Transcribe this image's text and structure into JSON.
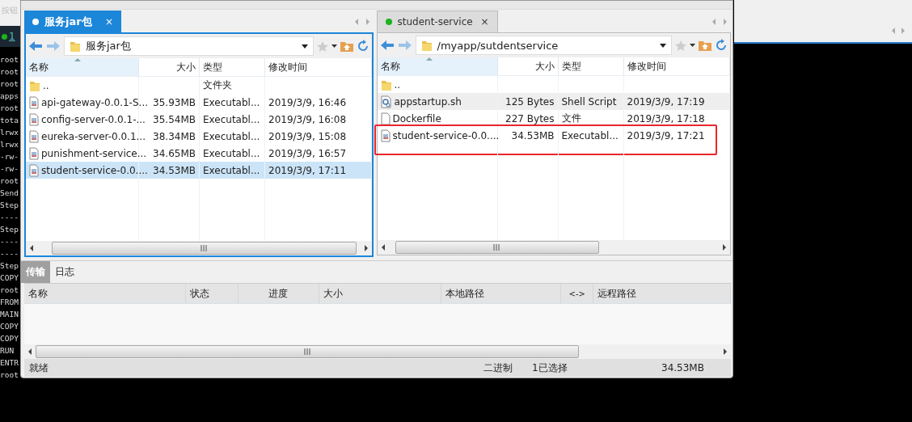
{
  "terminal": {
    "tab_label": "1",
    "lines": [
      "root",
      "root",
      "root",
      "apps",
      "root",
      "tota",
      "lrwx",
      "lrwx",
      "-rw-",
      "-rw-",
      "root",
      "Send",
      "Step",
      "----",
      "Step",
      "----",
      "----",
      "Step",
      "COPY",
      "root",
      "FROM",
      "MAIN",
      "COPY",
      "COPY",
      "RUN",
      "ENTR",
      "root"
    ]
  },
  "background_hint": "按钮",
  "panes": [
    {
      "tab": {
        "label": "服务jar包",
        "active": true,
        "color": "#ffffff",
        "close": "×"
      },
      "path": "服务jar包",
      "columns": [
        "名称",
        "大小",
        "类型",
        "修改时间"
      ],
      "rows": [
        {
          "kind": "folder",
          "name": "..",
          "size": "",
          "type": "文件夹",
          "modified": "",
          "selected": false,
          "hovered": false,
          "highlighted": false
        },
        {
          "kind": "executable",
          "name": "api-gateway-0.0.1-S...",
          "size": "35.93MB",
          "type": "Executabl...",
          "modified": "2019/3/9, 16:46",
          "selected": false,
          "hovered": false,
          "highlighted": false
        },
        {
          "kind": "executable",
          "name": "config-server-0.0.1-...",
          "size": "35.54MB",
          "type": "Executabl...",
          "modified": "2019/3/9, 16:08",
          "selected": false,
          "hovered": false,
          "highlighted": false
        },
        {
          "kind": "executable",
          "name": "eureka-server-0.0.1...",
          "size": "38.34MB",
          "type": "Executabl...",
          "modified": "2019/3/9, 15:08",
          "selected": false,
          "hovered": false,
          "highlighted": false
        },
        {
          "kind": "executable",
          "name": "punishment-service...",
          "size": "34.65MB",
          "type": "Executabl...",
          "modified": "2019/3/9, 16:57",
          "selected": false,
          "hovered": false,
          "highlighted": false
        },
        {
          "kind": "executable",
          "name": "student-service-0.0....",
          "size": "34.53MB",
          "type": "Executabl...",
          "modified": "2019/3/9, 17:11",
          "selected": true,
          "hovered": false,
          "highlighted": false
        }
      ]
    },
    {
      "tab": {
        "label": "student-service",
        "active": false,
        "color": "#1db31d",
        "close": "×"
      },
      "path": "/myapp/sutdentservice",
      "columns": [
        "名称",
        "大小",
        "类型",
        "修改时间"
      ],
      "rows": [
        {
          "kind": "folder",
          "name": "..",
          "size": "",
          "type": "",
          "modified": "",
          "selected": false,
          "hovered": false,
          "highlighted": false
        },
        {
          "kind": "script",
          "name": "appstartup.sh",
          "size": "125 Bytes",
          "type": "Shell Script",
          "modified": "2019/3/9, 17:19",
          "selected": false,
          "hovered": true,
          "highlighted": false
        },
        {
          "kind": "file",
          "name": "Dockerfile",
          "size": "227 Bytes",
          "type": "文件",
          "modified": "2019/3/9, 17:18",
          "selected": false,
          "hovered": false,
          "highlighted": false
        },
        {
          "kind": "executable",
          "name": "student-service-0.0....",
          "size": "34.53MB",
          "type": "Executabl...",
          "modified": "2019/3/9, 17:21",
          "selected": false,
          "hovered": false,
          "highlighted": true
        }
      ]
    }
  ],
  "bottom_tabs": [
    {
      "label": "传输",
      "selected": true
    },
    {
      "label": "日志",
      "selected": false
    }
  ],
  "transfer_columns": [
    "名称",
    "状态",
    "进度",
    "大小",
    "本地路径",
    "<->",
    "远程路径"
  ],
  "status_bar": {
    "state": "就绪",
    "mode": "二进制",
    "selection": "1已选择",
    "size": "34.53MB"
  }
}
